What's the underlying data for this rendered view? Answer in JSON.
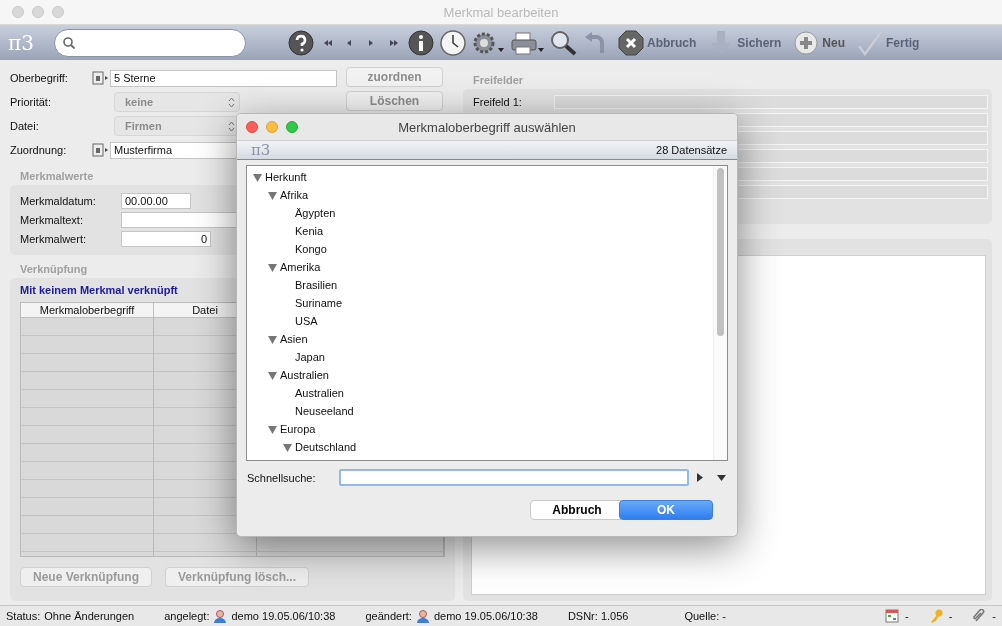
{
  "window": {
    "title": "Merkmal bearbeiten",
    "logo": "π3"
  },
  "toolbar": {
    "actions": [
      {
        "kind": "cancel",
        "label": "Abbruch",
        "disabled": true
      },
      {
        "kind": "save",
        "label": "Sichern",
        "disabled": true
      },
      {
        "kind": "new",
        "label": "Neu",
        "disabled": false
      },
      {
        "kind": "done",
        "label": "Fertig",
        "disabled": true
      }
    ]
  },
  "form": [
    {
      "kind": "link",
      "label": "Oberbegriff:",
      "value": "5 Sterne"
    },
    {
      "kind": "select",
      "label": "Priorität:",
      "value": "keine"
    },
    {
      "kind": "select",
      "label": "Datei:",
      "value": "Firmen"
    },
    {
      "kind": "link",
      "label": "Zuordnung:",
      "value": "Musterfirma"
    }
  ],
  "form_buttons": [
    {
      "label": "zuordnen"
    },
    {
      "label": "Löschen"
    }
  ],
  "merkmalwerte": {
    "title": "Merkmalwerte",
    "fields": [
      {
        "kind": "date",
        "label": "Merkmaldatum:",
        "value": "00.00.00"
      },
      {
        "kind": "text",
        "label": "Merkmaltext:"
      },
      {
        "kind": "number",
        "label": "Merkmalwert:",
        "value": "0"
      }
    ]
  },
  "verknuepfung": {
    "title": "Verknüpfung",
    "message": "Mit keinem Merkmal verknüpft",
    "columns": [
      "Merkmaloberbegriff",
      "Datei"
    ],
    "buttons": [
      {
        "label": "Neue Verknüpfung",
        "disabled": true
      },
      {
        "label": "Verknüpfung lösch...",
        "disabled": true
      }
    ]
  },
  "freifelder": {
    "title": "Freifelder",
    "fields": [
      {
        "label": "Freifeld 1:"
      }
    ]
  },
  "dialog": {
    "title": "Merkmaloberbegriff auswählen",
    "logo": "π3",
    "count": "28 Datensätze",
    "tree": [
      {
        "label": "Herkunft",
        "expanded": true,
        "children": [
          {
            "label": "Afrika",
            "expanded": true,
            "children": [
              {
                "label": "Ägypten"
              },
              {
                "label": "Kenia"
              },
              {
                "label": "Kongo"
              }
            ]
          },
          {
            "label": "Amerika",
            "expanded": true,
            "children": [
              {
                "label": "Brasilien"
              },
              {
                "label": "Suriname"
              },
              {
                "label": "USA"
              }
            ]
          },
          {
            "label": "Asien",
            "expanded": true,
            "children": [
              {
                "label": "Japan"
              }
            ]
          },
          {
            "label": "Australien",
            "expanded": true,
            "children": [
              {
                "label": "Australien"
              },
              {
                "label": "Neuseeland"
              }
            ]
          },
          {
            "label": "Europa",
            "expanded": true,
            "children": [
              {
                "label": "Deutschland",
                "expanded": true
              }
            ]
          }
        ]
      }
    ],
    "search_label": "Schnellsuche:",
    "buttons": [
      {
        "label": "Abbruch",
        "default": false
      },
      {
        "label": "OK",
        "default": true
      }
    ]
  },
  "status_bar": {
    "status_label": "Status:",
    "status": "Ohne Änderungen",
    "created_label": "angelegt:",
    "created": "demo 19.05.06/10:38",
    "changed_label": "geändert:",
    "changed": "demo 19.05.06/10:38",
    "dsnr": "DSNr: 1.056",
    "source": "Quelle: -",
    "indicators": [
      {
        "kind": "calendar",
        "value": "-"
      },
      {
        "kind": "key",
        "value": "-"
      },
      {
        "kind": "clip",
        "value": "-"
      }
    ]
  }
}
